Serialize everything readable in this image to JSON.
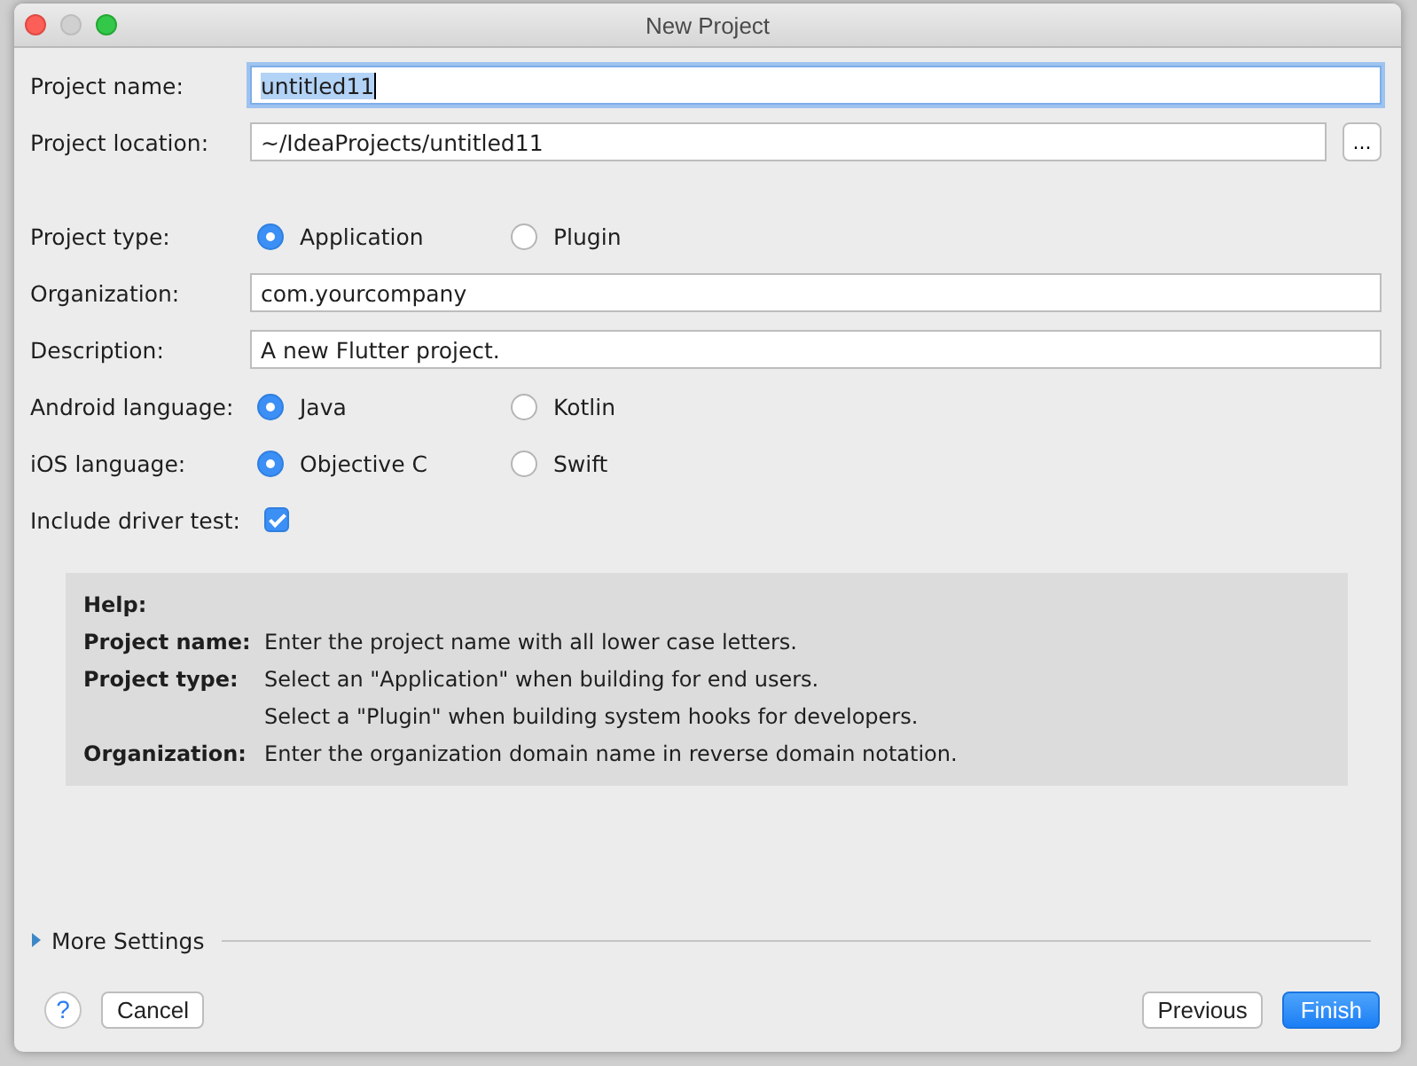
{
  "window": {
    "title": "New Project"
  },
  "sections": [
    [
      {
        "kind": "text",
        "label": "Project name:",
        "value": "untitled11",
        "focused": true
      },
      {
        "kind": "text",
        "label": "Project location:",
        "value": "~/IdeaProjects/untitled11",
        "focused": false,
        "button": "..."
      }
    ],
    [
      {
        "kind": "radio",
        "label": "Project type:",
        "options": [
          {
            "label": "Application",
            "selected": true
          },
          {
            "label": "Plugin",
            "selected": false
          }
        ]
      },
      {
        "kind": "text",
        "label": "Organization:",
        "value": "com.yourcompany",
        "focused": false
      },
      {
        "kind": "text",
        "label": "Description:",
        "value": "A new Flutter project.",
        "focused": false
      },
      {
        "kind": "radio",
        "label": "Android language:",
        "options": [
          {
            "label": "Java",
            "selected": true
          },
          {
            "label": "Kotlin",
            "selected": false
          }
        ]
      },
      {
        "kind": "radio",
        "label": "iOS language:",
        "options": [
          {
            "label": "Objective C",
            "selected": true
          },
          {
            "label": "Swift",
            "selected": false
          }
        ]
      },
      {
        "kind": "checkbox",
        "label": "Include driver test:",
        "checked": true
      }
    ]
  ],
  "help": {
    "title": "Help:",
    "entries": [
      {
        "term": "Project name:",
        "lines": [
          "Enter the project name with all lower case letters."
        ]
      },
      {
        "term": "Project type:",
        "lines": [
          "Select an \"Application\" when building for end users.",
          "Select a \"Plugin\" when building system hooks for developers."
        ]
      },
      {
        "term": "Organization:",
        "lines": [
          "Enter the organization domain name in reverse domain notation."
        ]
      }
    ]
  },
  "more_settings": {
    "label": "More Settings",
    "expanded": false
  },
  "buttons": {
    "help": "?",
    "left": [
      {
        "label": "Cancel",
        "default": false
      }
    ],
    "right": [
      {
        "label": "Previous",
        "default": false
      },
      {
        "label": "Finish",
        "default": true
      }
    ]
  }
}
